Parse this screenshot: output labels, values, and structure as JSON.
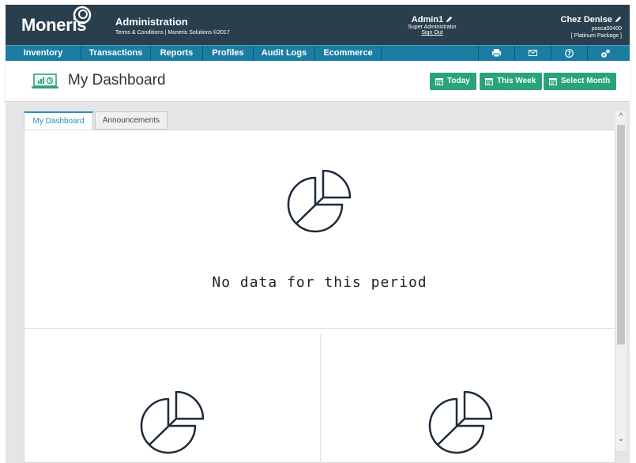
{
  "header": {
    "logo": "Moneris",
    "app_title": "Administration",
    "app_subtitle": "Terms & Conditions | Moneris Solutions ©2017",
    "user_name": "Admin1",
    "user_role": "Super Administrator",
    "sign_out": "Sign Out",
    "store_name": "Chez Denise",
    "store_id": "posca00400",
    "store_package": "[ Platinum Package ]"
  },
  "nav": {
    "items": [
      "Inventory",
      "Transactions",
      "Reports",
      "Profiles",
      "Audit Logs",
      "Ecommerce"
    ],
    "icons": [
      "printer-icon",
      "mail-icon",
      "help-icon",
      "settings-icon"
    ]
  },
  "titlebar": {
    "title": "My Dashboard",
    "buttons": [
      "Today",
      "This Week",
      "Select Month"
    ]
  },
  "tabs": [
    "My Dashboard",
    "Announcements"
  ],
  "main": {
    "no_data": "No data for this period"
  },
  "colors": {
    "header_bg": "#2a3f4e",
    "nav_bg": "#1b7da3",
    "button_bg": "#2aa37c",
    "tab_accent": "#2a8fc2"
  }
}
